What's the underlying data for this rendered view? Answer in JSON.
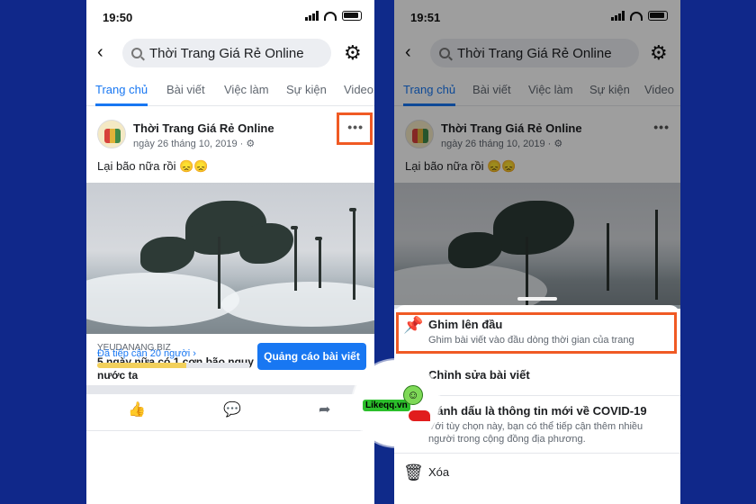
{
  "left": {
    "status_time": "19:50",
    "search_text": "Thời Trang Giá Rẻ Online",
    "tabs": [
      "Trang chủ",
      "Bài viết",
      "Việc làm",
      "Sự kiện",
      "Video"
    ],
    "post": {
      "author": "Thời Trang Giá Rẻ Online",
      "date": "ngày 26 tháng 10, 2019 · ⚙",
      "text": "Lại bão nữa rồi 😞😞",
      "more": "•••",
      "link_domain": "YEUDANANG.BIZ",
      "link_title": "5 ngày nữa có 1 cơn bão nguy hiểm hướng vào nước ta"
    },
    "reach_text": "Đã tiếp cận 20 người ›",
    "promote_label": "Quảng cáo bài viết",
    "reach_progress": 0.58
  },
  "right": {
    "status_time": "19:51",
    "search_text": "Thời Trang Giá Rẻ Online",
    "tabs": [
      "Trang chủ",
      "Bài viết",
      "Việc làm",
      "Sự kiện",
      "Video"
    ],
    "post": {
      "author": "Thời Trang Giá Rẻ Online",
      "date": "ngày 26 tháng 10, 2019 · ⚙",
      "text": "Lại bão nữa rồi 😞😞",
      "more": "•••"
    },
    "menu": {
      "pin_title": "Ghim lên đầu",
      "pin_desc": "Ghim bài viết vào đầu dòng thời gian của trang",
      "edit_title": "Chỉnh sửa bài viết",
      "covid_title": "Đánh dấu là thông tin mới về COVID-19",
      "covid_desc": "Với tùy chọn này, bạn có thể tiếp cận thêm nhiều người trong cộng đồng địa phương.",
      "delete_title": "Xóa"
    }
  },
  "watermark": {
    "logo_text": "Likeqq.vn"
  },
  "colors": {
    "accent": "#1877f2",
    "highlight": "#f05a24",
    "background": "#0f2a8a"
  }
}
